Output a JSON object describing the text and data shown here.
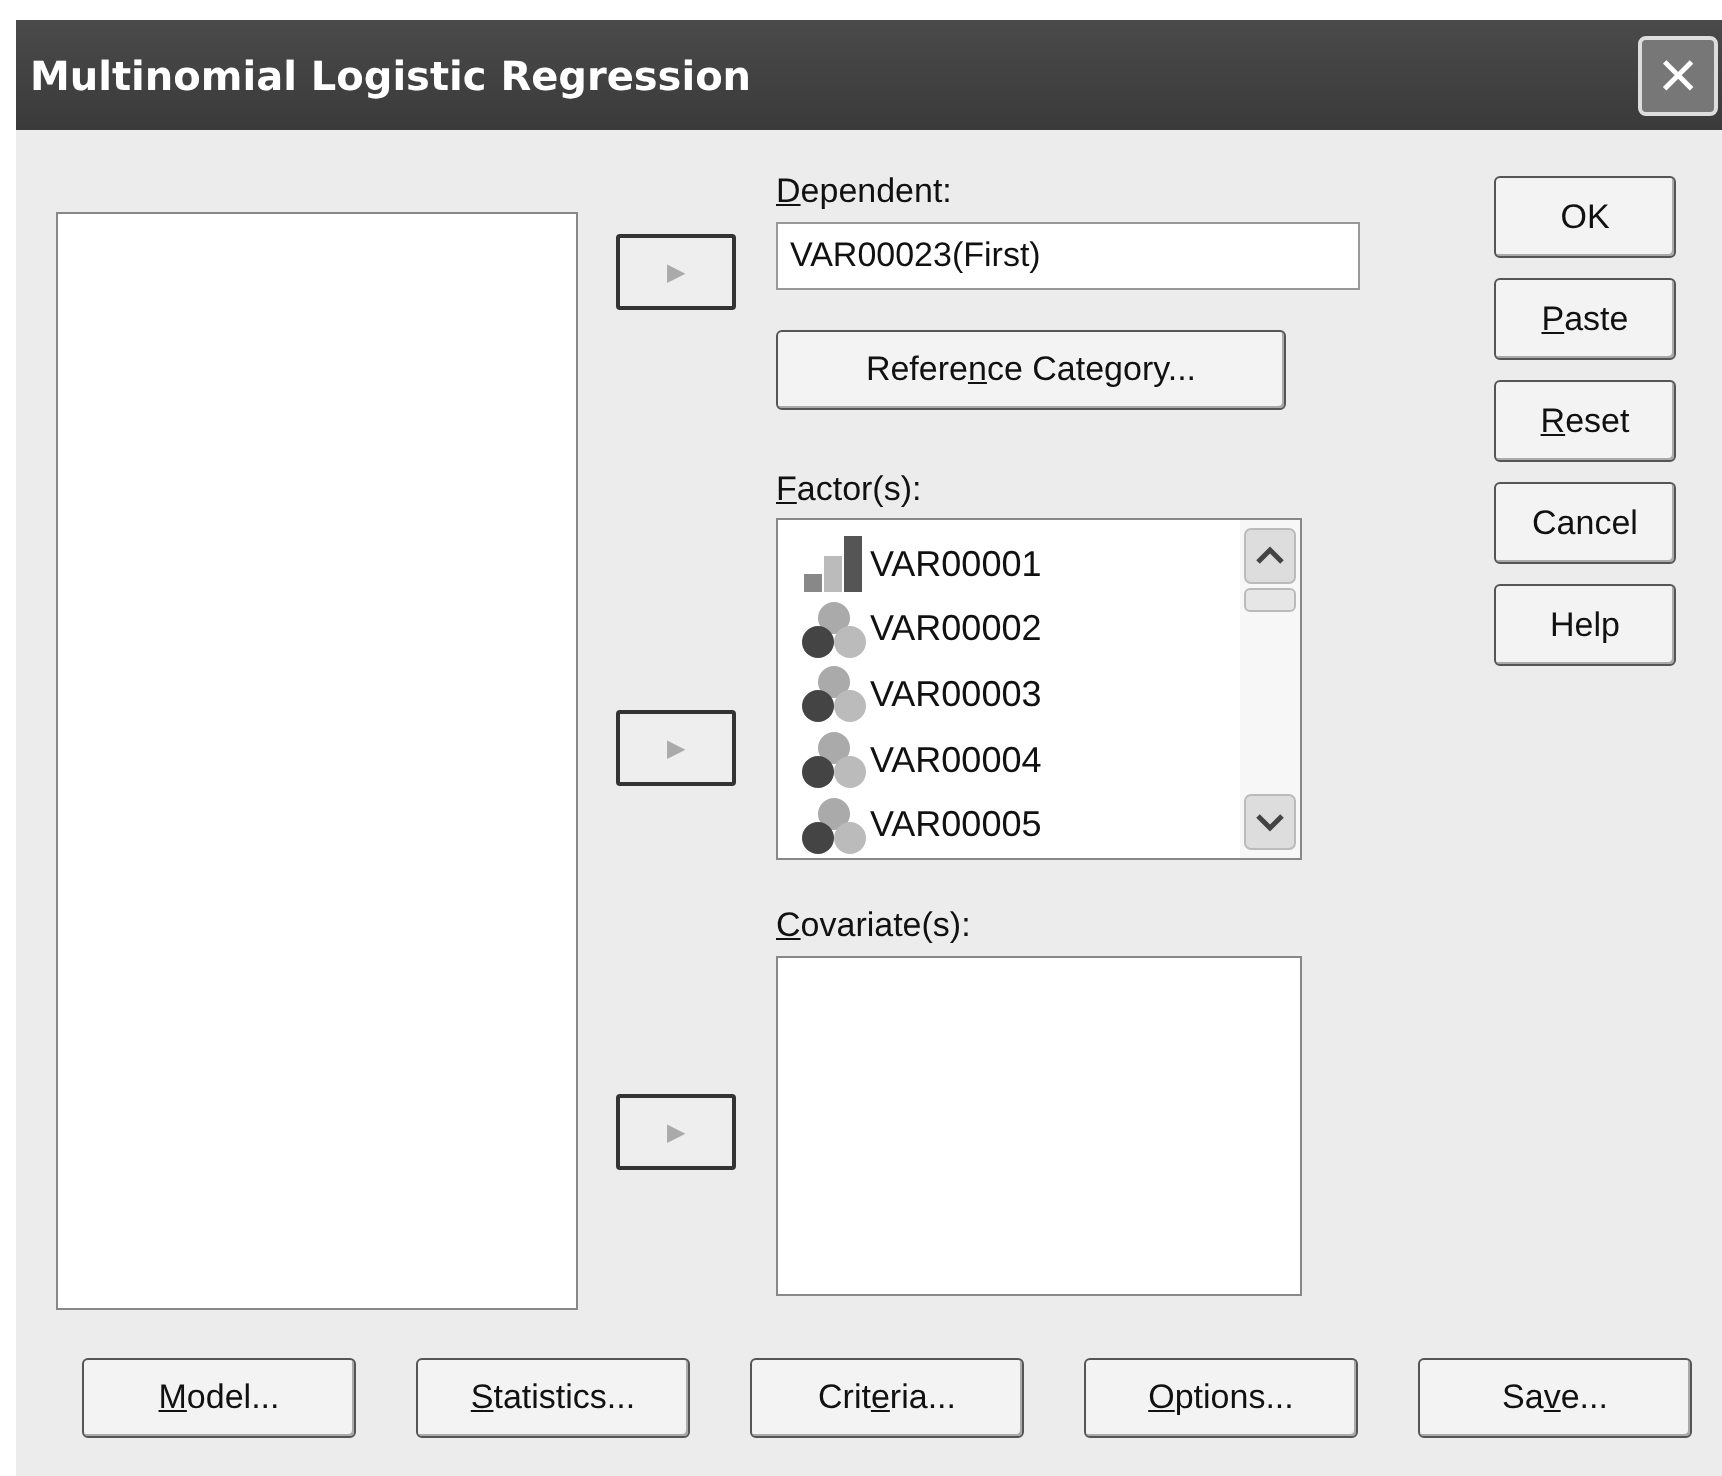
{
  "window": {
    "title": "Multinomial Logistic Regression",
    "close": "×"
  },
  "arrow": "▶",
  "dependent": {
    "label": {
      "key": "D",
      "after": "ependent:"
    },
    "value": "VAR00023(First)"
  },
  "reference_button": {
    "before": "Refere",
    "key": "n",
    "after": "ce Category..."
  },
  "factors": {
    "label": {
      "key": "F",
      "after": "actor(s):"
    },
    "items": [
      {
        "name": "VAR00001",
        "kind": "ordinal"
      },
      {
        "name": "VAR00002",
        "kind": "nominal"
      },
      {
        "name": "VAR00003",
        "kind": "nominal"
      },
      {
        "name": "VAR00004",
        "kind": "nominal"
      },
      {
        "name": "VAR00005",
        "kind": "nominal"
      }
    ]
  },
  "covariates": {
    "label": {
      "key": "C",
      "after": "ovariate(s):"
    }
  },
  "side_buttons": [
    {
      "before": "OK"
    },
    {
      "key": "P",
      "after": "aste"
    },
    {
      "key": "R",
      "after": "eset"
    },
    {
      "before": "Cancel"
    },
    {
      "before": "Help"
    }
  ],
  "bottom_buttons": [
    {
      "key": "M",
      "after": "odel..."
    },
    {
      "key": "S",
      "after": "tatistics..."
    },
    {
      "before": "Crit",
      "key": "e",
      "after": "ria..."
    },
    {
      "key": "O",
      "after": "ptions..."
    },
    {
      "before": "Sa",
      "key": "v",
      "after": "e..."
    }
  ]
}
